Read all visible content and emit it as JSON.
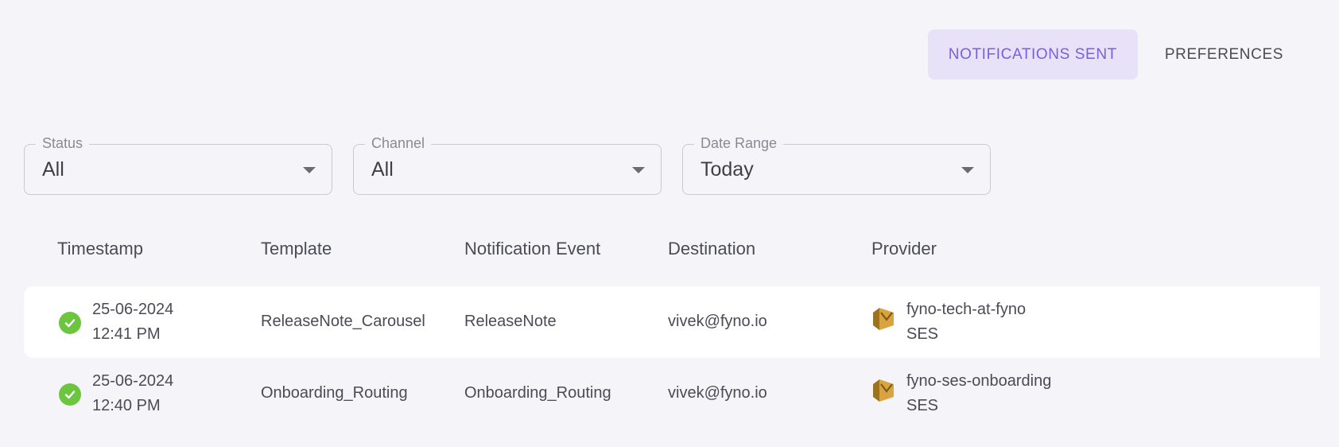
{
  "tabs": [
    {
      "label": "NOTIFICATIONS SENT",
      "active": true
    },
    {
      "label": "PREFERENCES",
      "active": false
    }
  ],
  "filters": [
    {
      "label": "Status",
      "value": "All"
    },
    {
      "label": "Channel",
      "value": "All"
    },
    {
      "label": "Date Range",
      "value": "Today"
    }
  ],
  "table": {
    "headers": [
      "Timestamp",
      "Template",
      "Notification Event",
      "Destination",
      "Provider"
    ],
    "rows": [
      {
        "status": "success",
        "date": "25-06-2024",
        "time": "12:41 PM",
        "template": "ReleaseNote_Carousel",
        "event": "ReleaseNote",
        "destination": "vivek@fyno.io",
        "provider_name": "fyno-tech-at-fyno",
        "provider_type": "SES"
      },
      {
        "status": "success",
        "date": "25-06-2024",
        "time": "12:40 PM",
        "template": "Onboarding_Routing",
        "event": "Onboarding_Routing",
        "destination": "vivek@fyno.io",
        "provider_name": "fyno-ses-onboarding",
        "provider_type": "SES"
      }
    ]
  },
  "colors": {
    "accent": "#7c5ce0",
    "accent_bg": "#e7e2f8",
    "success": "#6cc53e",
    "background": "#f4f4f9"
  },
  "icons": {
    "status": "check-circle-icon",
    "provider": "amazon-ses-icon",
    "dropdown": "caret-down-icon"
  }
}
